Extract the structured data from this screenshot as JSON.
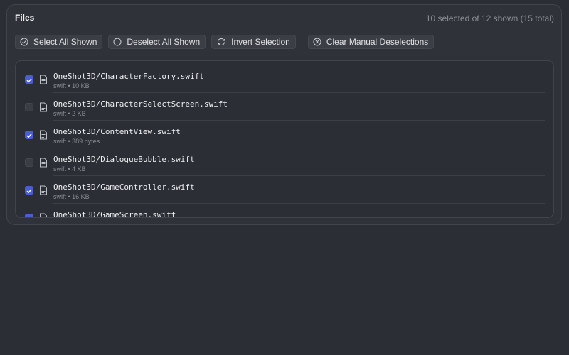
{
  "panel": {
    "title": "Files",
    "summary": "10 selected of 12 shown (15 total)"
  },
  "toolbar": {
    "select_all": "Select All Shown",
    "deselect_all": "Deselect All Shown",
    "invert": "Invert Selection",
    "clear_manual": "Clear Manual Deselections"
  },
  "files": [
    {
      "name": "OneShot3D/CharacterFactory.swift",
      "meta": "swift • 10 KB",
      "checked": true
    },
    {
      "name": "OneShot3D/CharacterSelectScreen.swift",
      "meta": "swift • 2 KB",
      "checked": false
    },
    {
      "name": "OneShot3D/ContentView.swift",
      "meta": "swift • 389 bytes",
      "checked": true
    },
    {
      "name": "OneShot3D/DialogueBubble.swift",
      "meta": "swift • 4 KB",
      "checked": false
    },
    {
      "name": "OneShot3D/GameController.swift",
      "meta": "swift • 16 KB",
      "checked": true
    },
    {
      "name": "OneShot3D/GameScreen.swift",
      "meta": "",
      "checked": true
    }
  ],
  "colors": {
    "accent": "#4a5fcf",
    "background": "#2b2e35",
    "panel": "#2f3239"
  },
  "icons": {
    "select_all": "check-circle-icon",
    "deselect_all": "circle-icon",
    "invert": "refresh-icon",
    "clear_manual": "x-circle-icon",
    "file": "document-icon"
  }
}
